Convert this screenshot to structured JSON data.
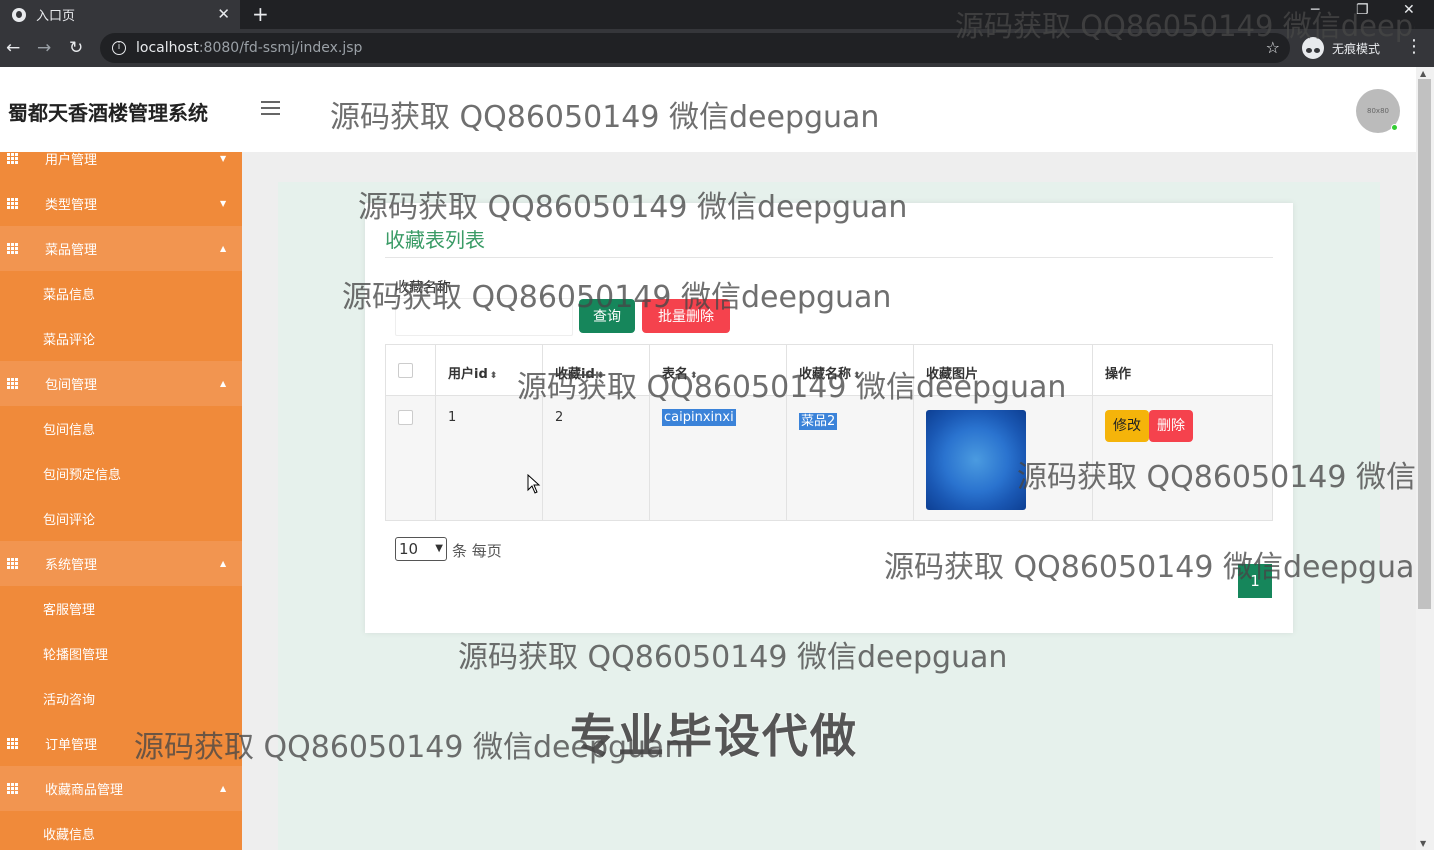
{
  "browser": {
    "tab_title": "入口页",
    "tab_close": "✕",
    "new_tab": "+",
    "url_host": "localhost",
    "url_path": ":8080/fd-ssmj/index.jsp",
    "incognito_label": "无痕模式",
    "win_min": "─",
    "win_max": "❐",
    "win_close": "✕"
  },
  "header": {
    "brand": "蜀都天香酒楼管理系统",
    "avatar_text": "80x80"
  },
  "sidebar": {
    "items": [
      {
        "label": "用户管理",
        "type": "group"
      },
      {
        "label": "类型管理",
        "type": "group"
      },
      {
        "label": "菜品管理",
        "type": "group"
      },
      {
        "label": "菜品信息",
        "type": "sub"
      },
      {
        "label": "菜品评论",
        "type": "sub"
      },
      {
        "label": "包间管理",
        "type": "group"
      },
      {
        "label": "包间信息",
        "type": "sub"
      },
      {
        "label": "包间预定信息",
        "type": "sub"
      },
      {
        "label": "包间评论",
        "type": "sub"
      },
      {
        "label": "系统管理",
        "type": "group"
      },
      {
        "label": "客服管理",
        "type": "sub"
      },
      {
        "label": "轮播图管理",
        "type": "sub"
      },
      {
        "label": "活动咨询",
        "type": "sub"
      },
      {
        "label": "订单管理",
        "type": "group"
      },
      {
        "label": "收藏商品管理",
        "type": "group"
      },
      {
        "label": "收藏信息",
        "type": "sub"
      }
    ]
  },
  "main": {
    "title": "收藏表列表",
    "filter_label": "收藏名称",
    "filter_value": "",
    "query_button": "查询",
    "batch_delete_button": "批量删除",
    "table": {
      "columns": [
        "用户id",
        "收藏id",
        "表名",
        "收藏名称",
        "收藏图片",
        "操作"
      ],
      "rows": [
        {
          "user_id": "1",
          "fav_id": "2",
          "table_name": "caipinxinxi",
          "fav_name": "菜品2",
          "edit": "修改",
          "delete": "删除"
        }
      ]
    },
    "page_size": "10",
    "page_size_label": "条 每页",
    "current_page": "1"
  },
  "watermarks": {
    "text": "源码获取 QQ86050149 微信deepguan",
    "text_short": "源码获取 QQ86050149 微信deepg",
    "text_cut": "源码获取 QQ86050149 微信de",
    "big": "专业毕设代做"
  },
  "colors": {
    "sidebar": "#f08a3a",
    "primary_green": "#16865b",
    "danger": "#f5424d",
    "warning": "#f5b40a",
    "title_green": "#3a9b66"
  }
}
